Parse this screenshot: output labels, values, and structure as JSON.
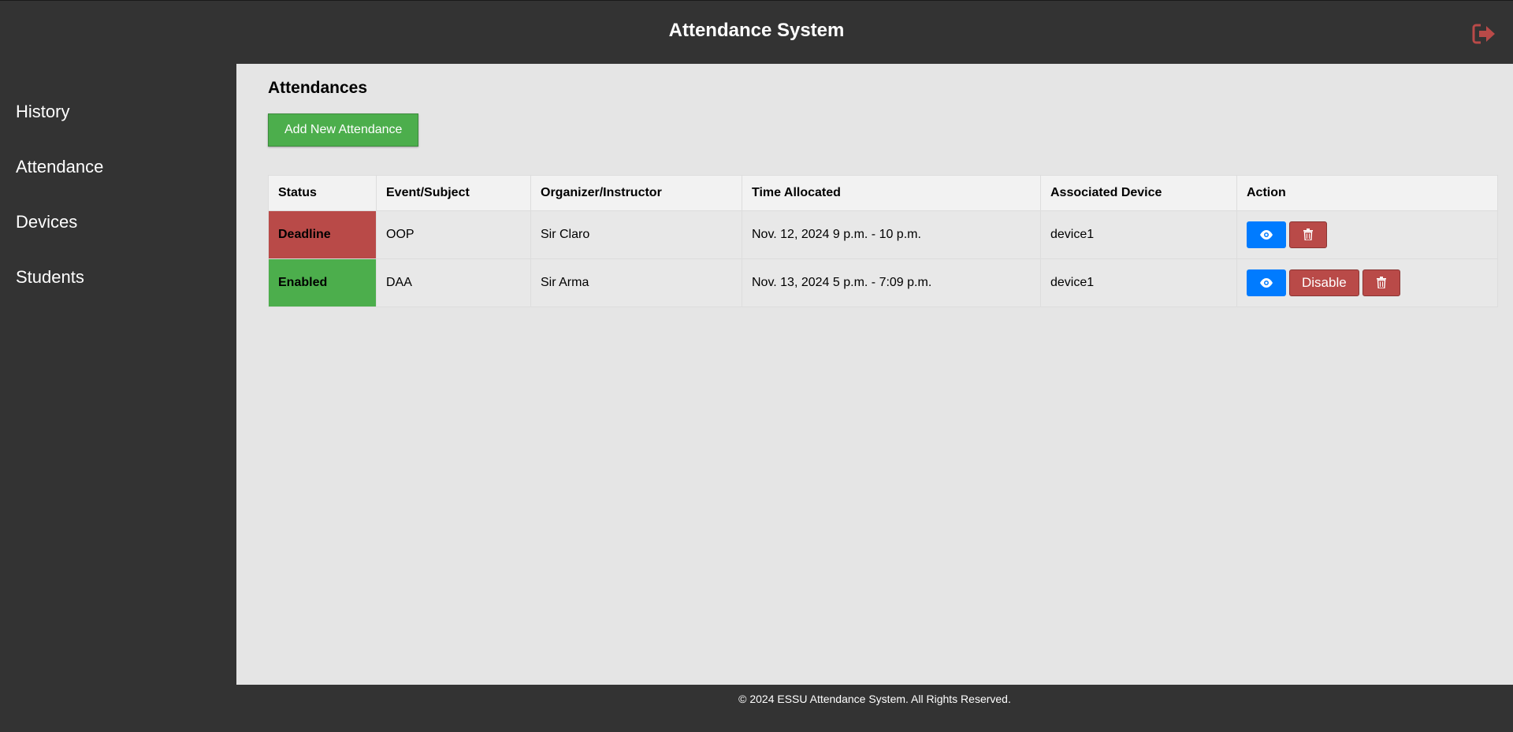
{
  "app": {
    "title": "Attendance System"
  },
  "header": {
    "logout_icon": "logout-icon"
  },
  "sidebar": {
    "items": [
      {
        "label": "History"
      },
      {
        "label": "Attendance"
      },
      {
        "label": "Devices"
      },
      {
        "label": "Students"
      }
    ]
  },
  "main": {
    "title": "Attendances",
    "add_button_label": "Add New Attendance",
    "table": {
      "headers": [
        "Status",
        "Event/Subject",
        "Organizer/Instructor",
        "Time Allocated",
        "Associated Device",
        "Action"
      ],
      "rows": [
        {
          "status": "Deadline",
          "status_color": "#b94a48",
          "event": "OOP",
          "organizer": "Sir Claro",
          "time": "Nov. 12, 2024 9 p.m. - 10 p.m.",
          "device": "device1"
        },
        {
          "status": "Enabled",
          "status_color": "#4cae4c",
          "event": "DAA",
          "organizer": "Sir Arma",
          "time": "Nov. 13, 2024 5 p.m. - 7:09 p.m.",
          "device": "device1",
          "disable_label": "Disable"
        }
      ]
    }
  },
  "footer": {
    "text": "© 2024 ESSU Attendance System. All Rights Reserved."
  },
  "colors": {
    "background_dark": "#333333",
    "content_bg": "#e5e5e5",
    "success": "#4cae4c",
    "danger": "#b94a48",
    "primary": "#007bff"
  }
}
